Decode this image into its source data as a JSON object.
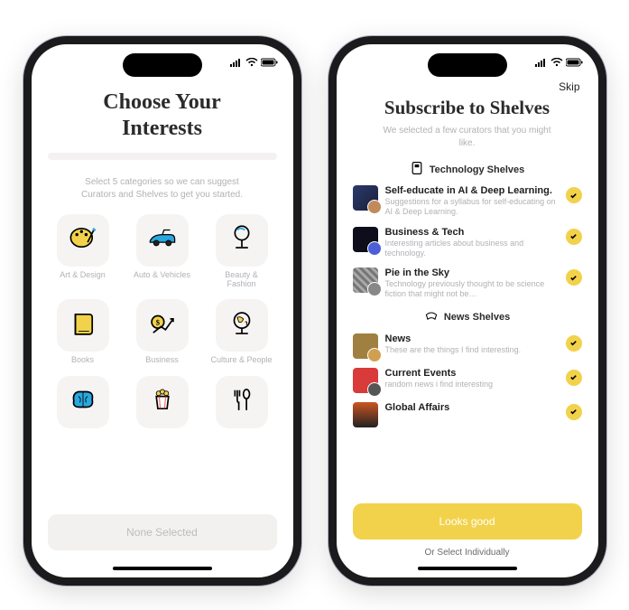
{
  "left": {
    "title_line1": "Choose Your",
    "title_line2": "Interests",
    "subtitle": "Select 5 categories so we can suggest Curators and Shelves to get you started.",
    "categories": [
      {
        "label": "Art & Design"
      },
      {
        "label": "Auto & Vehicles"
      },
      {
        "label": "Beauty & Fashion"
      },
      {
        "label": "Books"
      },
      {
        "label": "Business"
      },
      {
        "label": "Culture & People"
      }
    ],
    "footer_button": "None Selected"
  },
  "right": {
    "skip": "Skip",
    "title": "Subscribe to Shelves",
    "subtitle": "We selected a few curators that you might like.",
    "section1": "Technology Shelves",
    "section2": "News Shelves",
    "shelves1": [
      {
        "title": "Self-educate in AI & Deep Learning.",
        "desc": "Suggestions for a syllabus for self-educating on AI & Deep Learning."
      },
      {
        "title": "Business & Tech",
        "desc": "Interesting articles about business and technology."
      },
      {
        "title": "Pie in the Sky",
        "desc": "Technology previously thought to be science fiction that might not be…"
      }
    ],
    "shelves2": [
      {
        "title": "News",
        "desc": "These are the things I find interesting."
      },
      {
        "title": "Current Events",
        "desc": "random news i find interesting"
      },
      {
        "title": "Global Affairs",
        "desc": ""
      }
    ],
    "cta": "Looks good",
    "or_select": "Or Select Individually"
  }
}
